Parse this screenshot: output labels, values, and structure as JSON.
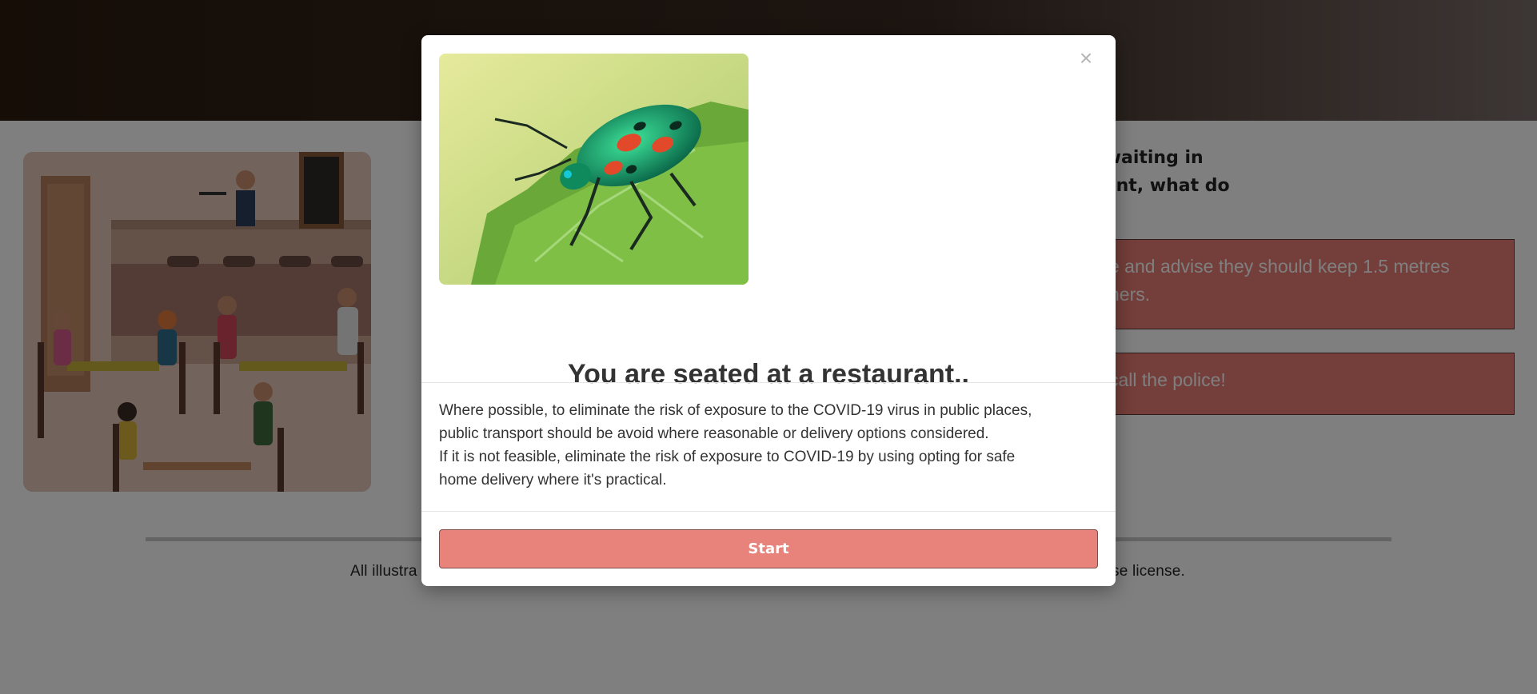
{
  "background": {
    "question_lines": [
      "people waiting in",
      "restaurant, what do"
    ],
    "answers": [
      {
        "text_lines": [
          "e and advise they should keep 1.5 metres",
          "hers."
        ]
      },
      {
        "text_lines": [
          "call the police!"
        ]
      }
    ],
    "credit_left": "All illustra",
    "credit_right": "se license."
  },
  "modal": {
    "image": "jewel-beetle-on-leaf",
    "title": "You are seated at a restaurant..",
    "body_lines": [
      "Where possible, to eliminate the risk of exposure to the COVID-19 virus in public places,",
      "public transport should be avoid where reasonable or delivery options considered.",
      "If it is not feasible, eliminate the risk of exposure to COVID-19 by using opting for safe",
      "home delivery where it's practical."
    ],
    "close_label": "×",
    "start_label": "Start"
  },
  "colors": {
    "accent": "#e8837b",
    "header_dark": "#2a1a0d"
  }
}
